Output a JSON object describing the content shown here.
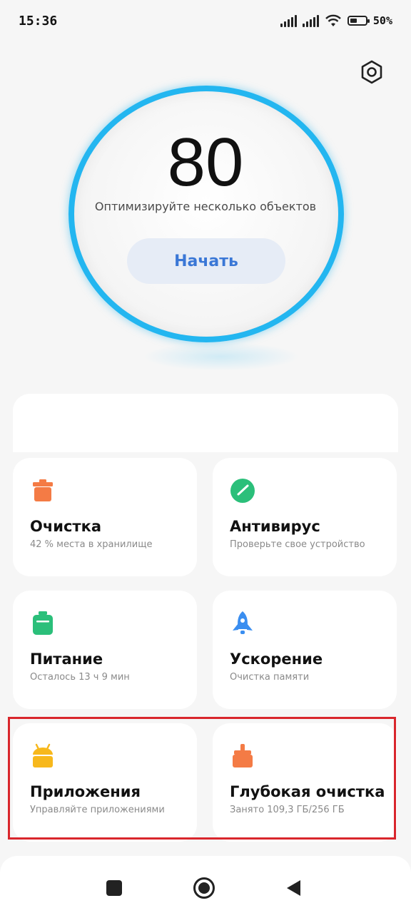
{
  "status_bar": {
    "time": "15:36",
    "battery_percent": "50%",
    "battery_level": 0.5
  },
  "header": {
    "settings_icon": "gear-icon"
  },
  "score": {
    "value": "80",
    "subtitle": "Оптимизируйте несколько объектов",
    "start_label": "Начать",
    "ring_color": "#23b6f0"
  },
  "cards": [
    {
      "title": "Очистка",
      "subtitle": "42 % места в хранилище",
      "icon": "trash-icon",
      "color": "#f47b45"
    },
    {
      "title": "Антивирус",
      "subtitle": "Проверьте свое устройство",
      "icon": "shield-check-icon",
      "color": "#2bbf7a"
    },
    {
      "title": "Питание",
      "subtitle": "Осталось 13 ч 9 мин",
      "icon": "battery-icon",
      "color": "#2bbf7a"
    },
    {
      "title": "Ускорение",
      "subtitle": "Очистка памяти",
      "icon": "rocket-icon",
      "color": "#3a8ef0"
    },
    {
      "title": "Приложения",
      "subtitle": "Управляйте приложениями",
      "icon": "android-icon",
      "color": "#f7b81c"
    },
    {
      "title": "Глубокая очистка",
      "subtitle": "Занято 109,3 ГБ/256 ГБ",
      "icon": "broom-icon",
      "color": "#f47b45"
    }
  ],
  "nav": {
    "recent_icon": "square-icon",
    "home_icon": "circle-icon",
    "back_icon": "triangle-back-icon"
  }
}
